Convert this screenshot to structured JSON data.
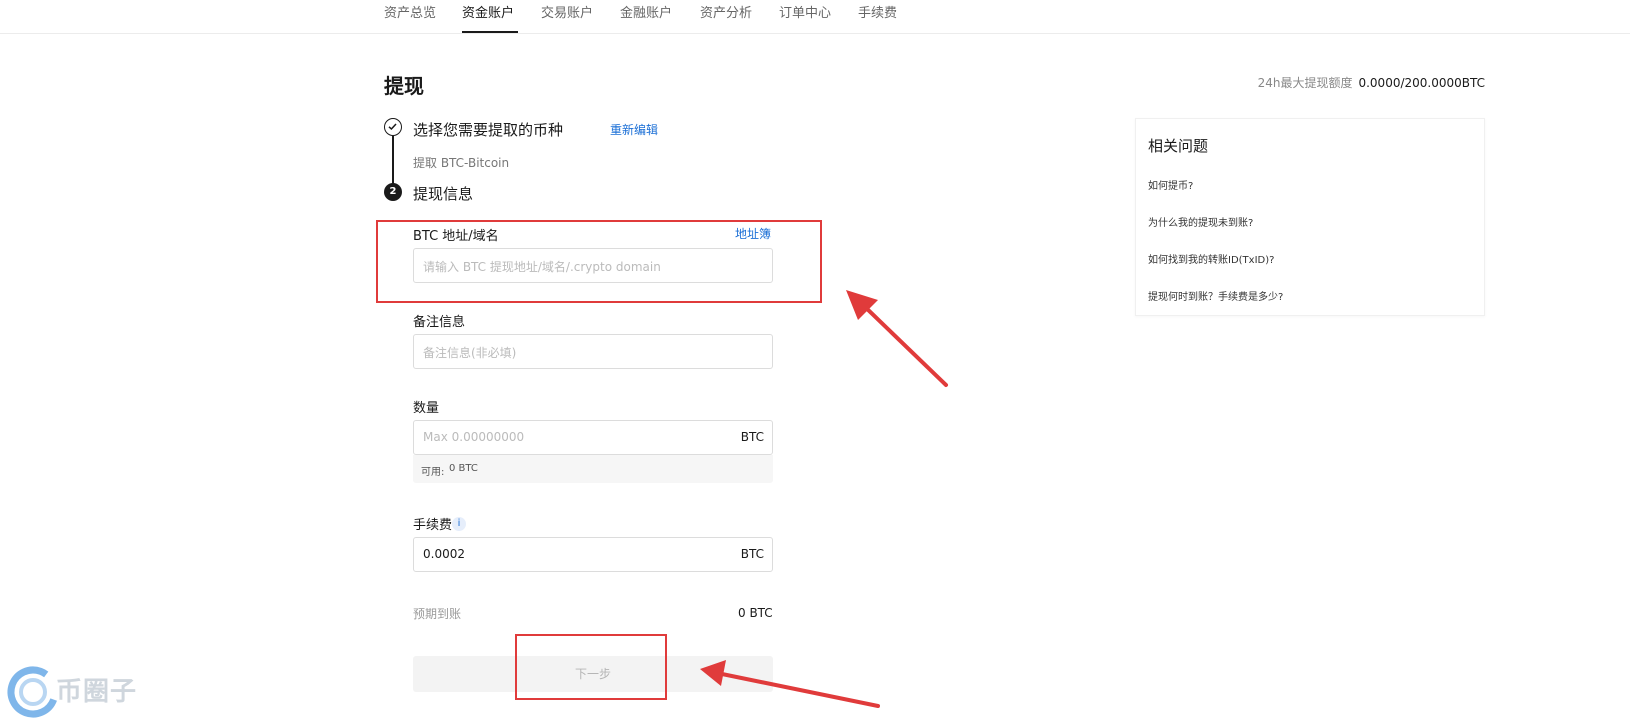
{
  "nav": {
    "tabs": [
      "资产总览",
      "资金账户",
      "交易账户",
      "金融账户",
      "资产分析",
      "订单中心",
      "手续费"
    ],
    "active_index": 1
  },
  "page": {
    "title": "提现",
    "limit_label": "24h最大提现额度",
    "limit_value": "0.0000/200.0000BTC"
  },
  "steps": {
    "step1": {
      "title": "选择您需要提取的币种",
      "edit": "重新编辑",
      "sub": "提取 BTC-Bitcoin"
    },
    "step2": {
      "num": "2",
      "title": "提现信息"
    }
  },
  "form": {
    "address": {
      "label": "BTC 地址/域名",
      "book": "地址簿",
      "placeholder": "请输入 BTC 提现地址/域名/.crypto domain"
    },
    "memo": {
      "label": "备注信息",
      "placeholder": "备注信息(非必填)"
    },
    "amount": {
      "label": "数量",
      "placeholder": "Max 0.00000000",
      "unit": "BTC",
      "avail_label": "可用:",
      "avail_value": "0 BTC"
    },
    "fee": {
      "label": "手续费",
      "info": "i",
      "value": "0.0002",
      "unit": "BTC"
    },
    "arrive": {
      "label": "预期到账",
      "value": "0 BTC"
    },
    "next": "下一步"
  },
  "faq": {
    "title": "相关问题",
    "items": [
      "如何提币?",
      "为什么我的提现未到账?",
      "如何找到我的转账ID(TxID)?",
      "提现何时到账？手续费是多少?"
    ]
  },
  "watermark": {
    "text": "币圈子"
  },
  "colors": {
    "accent": "#1b6fd6",
    "annotation": "#e03b3b",
    "primary": "#1a1a1a"
  }
}
